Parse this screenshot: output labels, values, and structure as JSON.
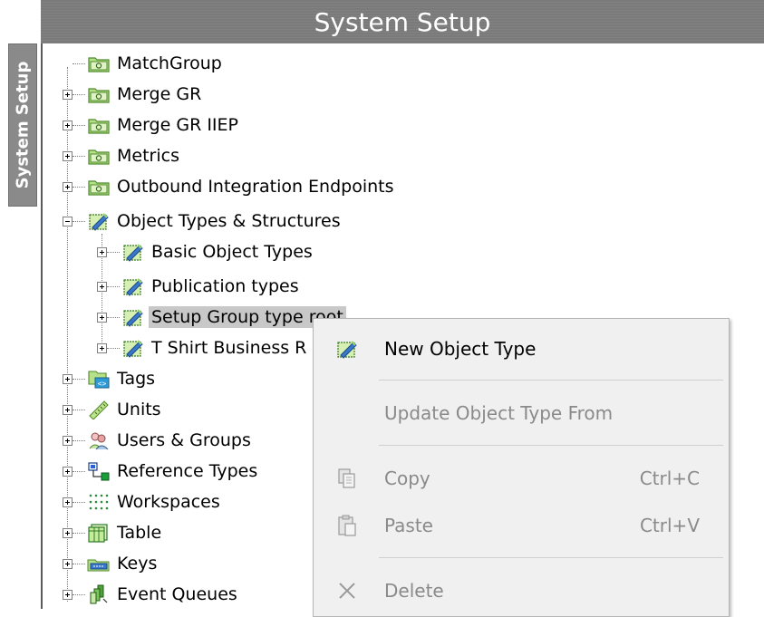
{
  "header": {
    "title": "System Setup"
  },
  "sidebar": {
    "tab_label": "System Setup"
  },
  "tree": {
    "nodes": [
      {
        "label": "MatchGroup",
        "icon": "folder-icon"
      },
      {
        "label": "Merge GR",
        "icon": "folder-icon"
      },
      {
        "label": "Merge GR IIEP",
        "icon": "folder-icon"
      },
      {
        "label": "Metrics",
        "icon": "folder-icon"
      },
      {
        "label": "Outbound Integration Endpoints",
        "icon": "folder-icon"
      },
      {
        "label": "Object Types & Structures",
        "icon": "object-type-icon"
      },
      {
        "label": "Basic Object Types",
        "icon": "object-type-icon"
      },
      {
        "label": "Publication types",
        "icon": "object-type-icon"
      },
      {
        "label": "Setup Group type root",
        "icon": "object-type-icon"
      },
      {
        "label": "T Shirt Business R",
        "icon": "object-type-icon"
      },
      {
        "label": "Tags",
        "icon": "tags-icon"
      },
      {
        "label": "Units",
        "icon": "ruler-icon"
      },
      {
        "label": "Users & Groups",
        "icon": "users-icon"
      },
      {
        "label": "Reference Types",
        "icon": "reference-types-icon"
      },
      {
        "label": "Workspaces",
        "icon": "workspaces-icon"
      },
      {
        "label": "Table",
        "icon": "table-icon"
      },
      {
        "label": "Keys",
        "icon": "keys-icon"
      },
      {
        "label": "Event Queues",
        "icon": "event-queues-icon"
      }
    ]
  },
  "context_menu": {
    "items": [
      {
        "label": "New Object Type",
        "shortcut": "",
        "icon": "object-type-icon",
        "enabled": true
      },
      {
        "label": "Update Object Type From",
        "shortcut": "",
        "icon": "",
        "enabled": false
      },
      {
        "label": "Copy",
        "shortcut": "Ctrl+C",
        "icon": "copy-icon",
        "enabled": false
      },
      {
        "label": "Paste",
        "shortcut": "Ctrl+V",
        "icon": "paste-icon",
        "enabled": false
      },
      {
        "label": "Delete",
        "shortcut": "",
        "icon": "delete-icon",
        "enabled": false
      }
    ]
  },
  "colors": {
    "header_bg": "#7a7a7a",
    "selection_bg": "#c8c8c8",
    "menu_bg": "#f0f0f0",
    "disabled_text": "#8a8a8a"
  }
}
